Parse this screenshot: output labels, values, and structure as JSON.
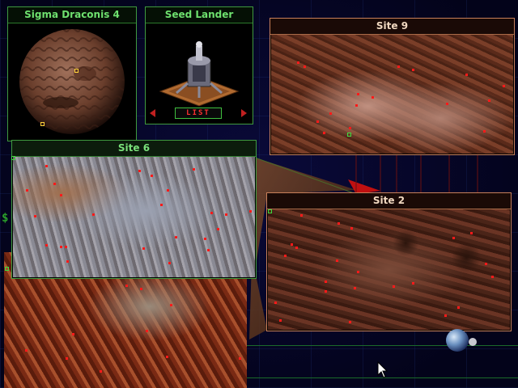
{
  "planet_panel": {
    "title": "Sigma Draconis 4"
  },
  "lander_panel": {
    "title": "Seed Lander",
    "list_label": "LIST"
  },
  "sites": [
    {
      "title": "Site 9"
    },
    {
      "title": "Site 6"
    },
    {
      "title": "Site 2"
    }
  ],
  "side_marker": "$",
  "colors": {
    "panel_border_green": "#3f9a3f",
    "title_green": "#6ee06e",
    "site_border_orange": "#c8805a",
    "survey_dot_red": "#ff1a1a",
    "background": "#04041e"
  },
  "icons": [
    "planet-globe",
    "lander-icon",
    "prev-arrow-icon",
    "next-arrow-icon",
    "moon-icon",
    "mouse-cursor-icon"
  ]
}
